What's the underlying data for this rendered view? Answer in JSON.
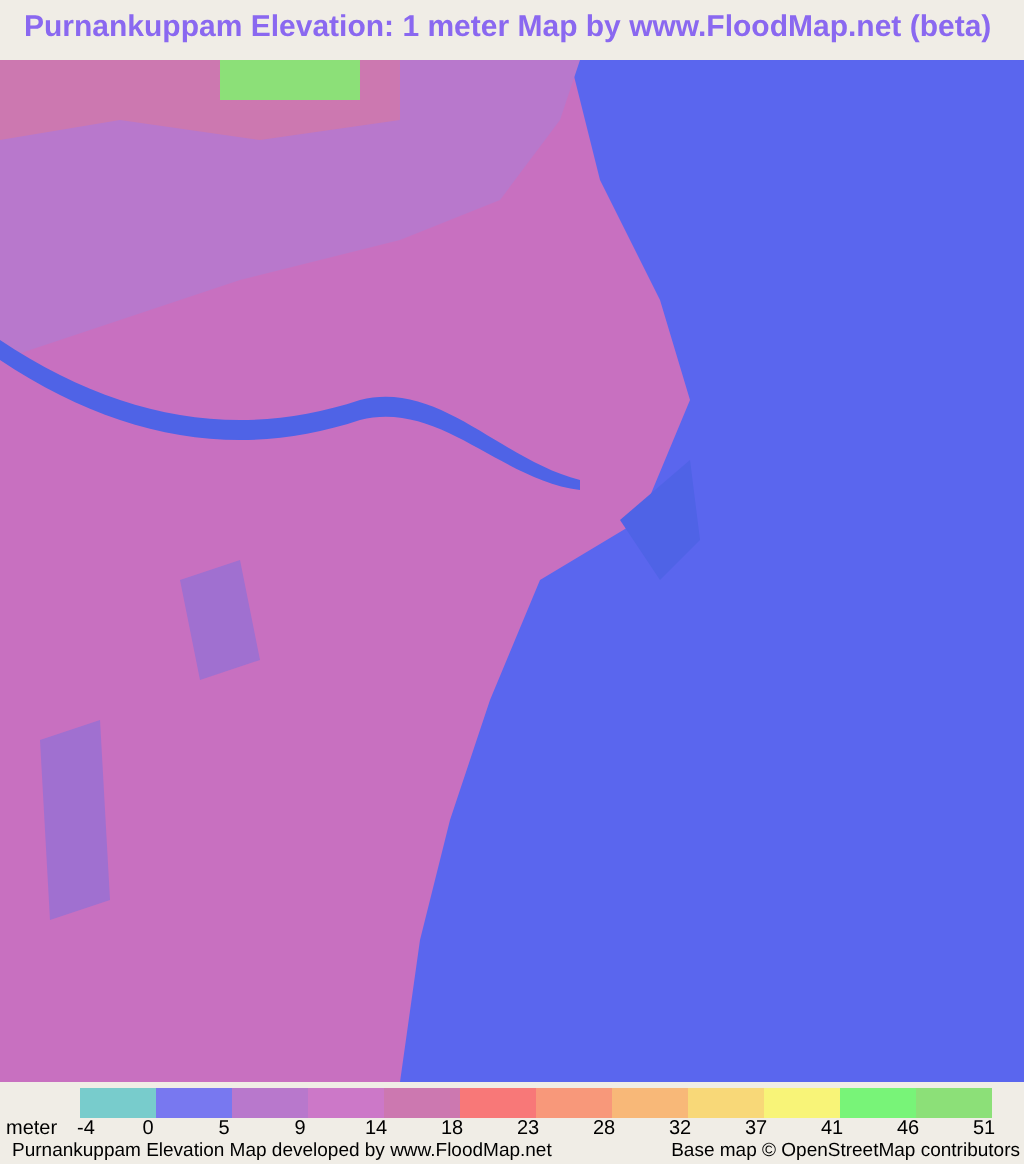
{
  "title": "Purnankuppam Elevation: 1 meter Map by www.FloodMap.net (beta)",
  "legend": {
    "unit": "meter",
    "swatches": [
      {
        "color": "#78cccc"
      },
      {
        "color": "#7878f0"
      },
      {
        "color": "#b878cc"
      },
      {
        "color": "#cc78c8"
      },
      {
        "color": "#cc78b0"
      },
      {
        "color": "#f87878"
      },
      {
        "color": "#f8987a"
      },
      {
        "color": "#f8b878"
      },
      {
        "color": "#f8d878"
      },
      {
        "color": "#f8f478"
      },
      {
        "color": "#78f478"
      },
      {
        "color": "#8ce078"
      }
    ],
    "ticks": [
      "-4",
      "0",
      "5",
      "9",
      "14",
      "18",
      "23",
      "28",
      "32",
      "37",
      "41",
      "46",
      "51"
    ]
  },
  "footer": {
    "left": "Purnankuppam Elevation Map developed by www.FloodMap.net",
    "right": "Base map © OpenStreetMap contributors"
  }
}
